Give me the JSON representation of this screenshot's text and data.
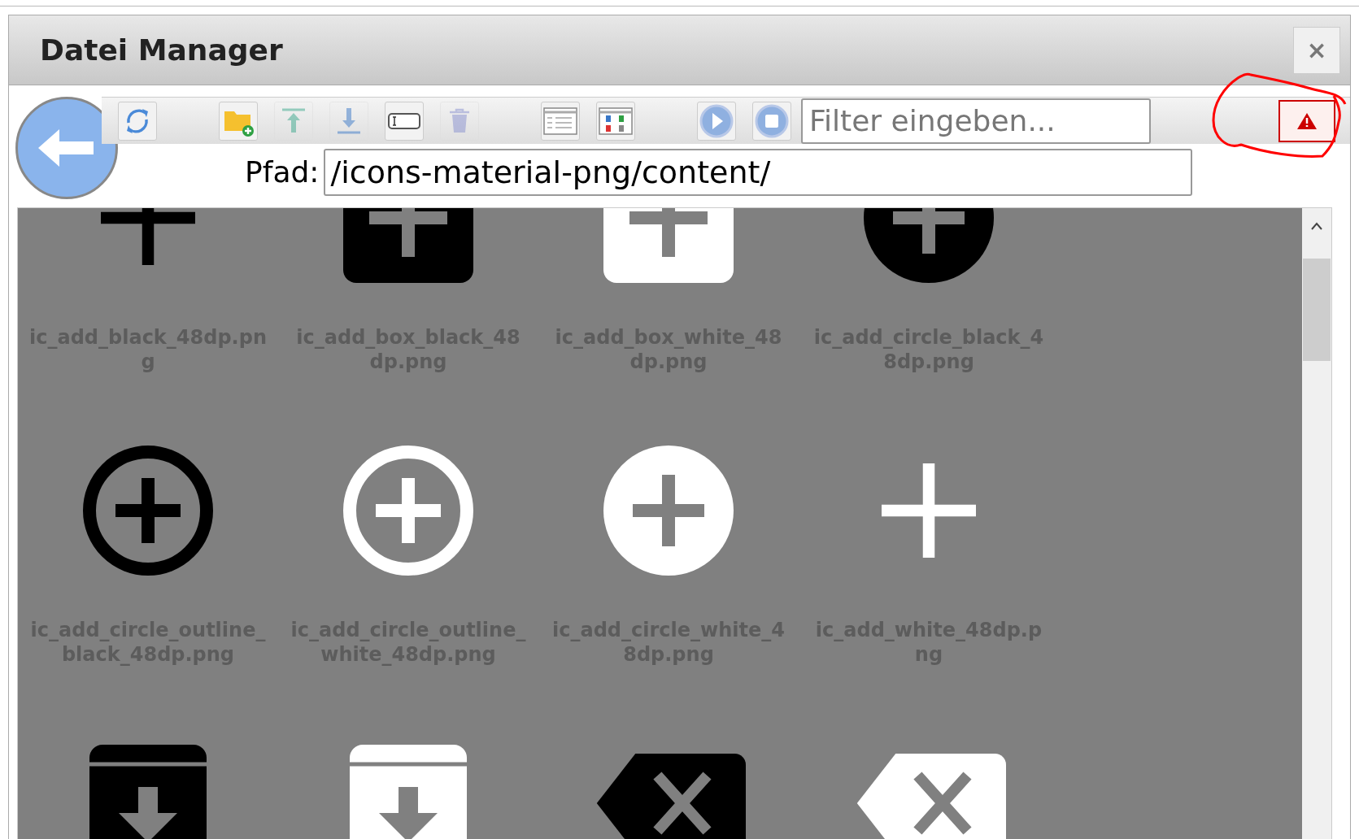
{
  "window": {
    "title": "Datei Manager",
    "close": "×"
  },
  "toolbar": {
    "buttons": [
      {
        "kind": "refresh",
        "disabled": false
      },
      {
        "kind": "new_folder",
        "disabled": false
      },
      {
        "kind": "upload",
        "disabled": true
      },
      {
        "kind": "download",
        "disabled": true
      },
      {
        "kind": "rename",
        "disabled": false
      },
      {
        "kind": "delete",
        "disabled": true
      },
      {
        "kind": "list_view",
        "disabled": false
      },
      {
        "kind": "thumbnail_view",
        "disabled": false
      },
      {
        "kind": "play",
        "disabled": false
      },
      {
        "kind": "stop",
        "disabled": false
      }
    ],
    "filter": {
      "placeholder": "Filter eingeben..."
    }
  },
  "path": {
    "label": "Pfad:",
    "value": "/icons-material-png/content/"
  },
  "files": [
    {
      "kind": "add",
      "color": "#000000",
      "label": "ic_add_black_48dp.png"
    },
    {
      "kind": "add_box",
      "color": "#000000",
      "label": "ic_add_box_black_48dp.png"
    },
    {
      "kind": "add_box",
      "color": "#ffffff",
      "label": "ic_add_box_white_48dp.png"
    },
    {
      "kind": "add_circle",
      "color": "#000000",
      "label": "ic_add_circle_black_48dp.png"
    },
    {
      "kind": "add_circle_outline",
      "color": "#000000",
      "label": "ic_add_circle_outline_black_48dp.png"
    },
    {
      "kind": "add_circle_outline",
      "color": "#ffffff",
      "label": "ic_add_circle_outline_white_48dp.png"
    },
    {
      "kind": "add_circle",
      "color": "#ffffff",
      "label": "ic_add_circle_white_48dp.png"
    },
    {
      "kind": "add",
      "color": "#ffffff",
      "label": "ic_add_white_48dp.png"
    },
    {
      "kind": "archive",
      "color": "#000000"
    },
    {
      "kind": "archive",
      "color": "#ffffff"
    },
    {
      "kind": "backspace",
      "color": "#000000"
    },
    {
      "kind": "backspace",
      "color": "#ffffff"
    }
  ]
}
